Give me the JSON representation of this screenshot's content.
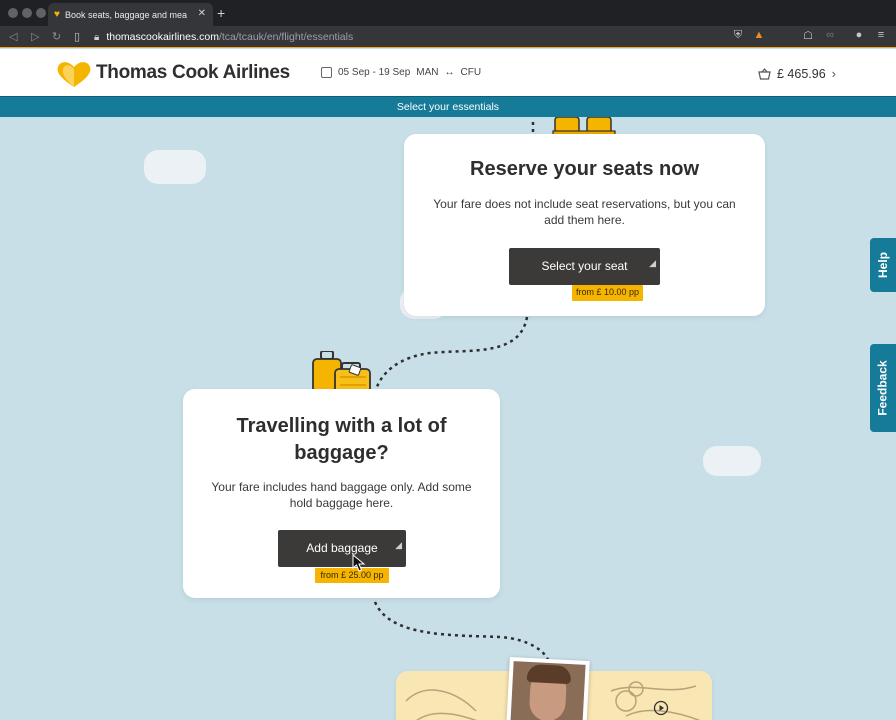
{
  "browser": {
    "tab_title": "Book seats, baggage and meals",
    "url_host": "thomascookairlines.com",
    "url_path": "/tca/tcauk/en/flight/essentials"
  },
  "header": {
    "brand": "Thomas Cook Airlines",
    "dates": "05 Sep - 19 Sep",
    "route_from": "MAN",
    "route_arrow": "↔",
    "route_to": "CFU",
    "basket_total": "£ 465.96"
  },
  "banner": {
    "title": "Select your essentials"
  },
  "seats_card": {
    "title": "Reserve your seats now",
    "text": "Your fare does not include seat reservations, but you can add them here.",
    "button": "Select your seat",
    "price": "from £ 10.00 pp"
  },
  "baggage_card": {
    "title_line1": "Travelling with a lot of",
    "title_line2": "baggage?",
    "text": "Your fare includes hand baggage only. Add some hold baggage here.",
    "button": "Add baggage",
    "price": "from £ 25.00 pp"
  },
  "side_tabs": {
    "help": "Help",
    "feedback": "Feedback"
  },
  "colors": {
    "brand_blue": "#167a99",
    "accent_yellow": "#f5b400",
    "button_dark": "#3c3a38",
    "background": "#c8dfe8"
  }
}
